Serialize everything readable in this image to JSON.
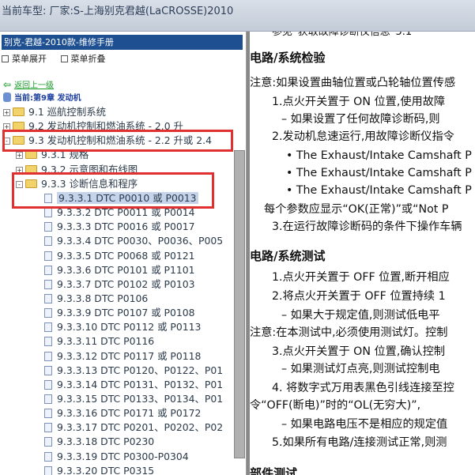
{
  "window": {
    "title": "当前车型:   厂家:S-上海别克君越(LaCROSSE)2010"
  },
  "left_panel": {
    "header": "别克-君越-2010款-维修手册",
    "toolbar": [
      "菜单展开",
      "菜单折叠"
    ],
    "back_link": "返回上一级",
    "chapter": "当前:第9章 发动机",
    "tree": [
      {
        "toggle": "+",
        "icon": "folder",
        "label": "9.1 巡航控制系统"
      },
      {
        "toggle": "+",
        "icon": "folder",
        "label": "9.2 发动机控制和燃油系统 - 2.0 升"
      },
      {
        "toggle": "-",
        "icon": "folder",
        "label": "9.3 发动机控制和燃油系统 - 2.2 升或 2.4"
      },
      {
        "toggle": "+",
        "icon": "folder",
        "label": "9.3.1 规格"
      },
      {
        "toggle": "+",
        "icon": "folder",
        "label": "9.3.2 示意图和布线图"
      },
      {
        "toggle": "-",
        "icon": "folder",
        "label": "9.3.3 诊断信息和程序"
      },
      {
        "toggle": "",
        "icon": "doc",
        "label": "9.3.3.1 DTC P0010 或 P0013",
        "selected": true
      },
      {
        "toggle": "",
        "icon": "doc",
        "label": "9.3.3.2 DTC P0011 或 P0014"
      },
      {
        "toggle": "",
        "icon": "doc",
        "label": "9.3.3.3 DTC P0016 或 P0017"
      },
      {
        "toggle": "",
        "icon": "doc",
        "label": "9.3.3.4 DTC P0030、P0036、P005"
      },
      {
        "toggle": "",
        "icon": "doc",
        "label": "9.3.3.5 DTC P0068 或 P0121"
      },
      {
        "toggle": "",
        "icon": "doc",
        "label": "9.3.3.6 DTC P0101 或 P1101"
      },
      {
        "toggle": "",
        "icon": "doc",
        "label": "9.3.3.7 DTC P0102 或 P0103"
      },
      {
        "toggle": "",
        "icon": "doc",
        "label": "9.3.3.8 DTC P0106"
      },
      {
        "toggle": "",
        "icon": "doc",
        "label": "9.3.3.9 DTC P0107 或 P0108"
      },
      {
        "toggle": "",
        "icon": "doc",
        "label": "9.3.3.10 DTC P0112 或 P0113"
      },
      {
        "toggle": "",
        "icon": "doc",
        "label": "9.3.3.11 DTC P0116"
      },
      {
        "toggle": "",
        "icon": "doc",
        "label": "9.3.3.12 DTC P0117 或 P0118"
      },
      {
        "toggle": "",
        "icon": "doc",
        "label": "9.3.3.13 DTC P0120、P0122、P01"
      },
      {
        "toggle": "",
        "icon": "doc",
        "label": "9.3.3.14 DTC P0131、P0132、P01"
      },
      {
        "toggle": "",
        "icon": "doc",
        "label": "9.3.3.15 DTC P0133、P0134、P01"
      },
      {
        "toggle": "",
        "icon": "doc",
        "label": "9.3.3.16 DTC P0171 或 P0172"
      },
      {
        "toggle": "",
        "icon": "doc",
        "label": "9.3.3.17 DTC P0201、P0202、P02"
      },
      {
        "toggle": "",
        "icon": "doc",
        "label": "9.3.3.18 DTC P0230"
      },
      {
        "toggle": "",
        "icon": "doc",
        "label": "9.3.3.19 DTC P0300-P0304"
      },
      {
        "toggle": "",
        "icon": "doc",
        "label": "9.3.3.20 DTC P0315"
      }
    ]
  },
  "content": {
    "top_line": "参见“获取故障诊断仪信息”5.1",
    "lines": [
      {
        "text": "电路/系统检验",
        "style": "heading"
      },
      {
        "text": "注意:如果设置曲轴位置或凸轮轴位置传感",
        "style": "note"
      },
      {
        "text": "1.点火开关置于 ON 位置,使用故障",
        "style": "step"
      },
      {
        "text": "– 如果设置了任何故障诊断码,则",
        "style": "sub"
      },
      {
        "text": "2.发动机怠速运行,用故障诊断仪指令",
        "style": "step"
      },
      {
        "text": "• The Exhaust/Intake Camshaft P",
        "style": "bullet"
      },
      {
        "text": "• The Exhaust/Intake Camshaft P",
        "style": "bullet"
      },
      {
        "text": "• The Exhaust/Intake Camshaft P",
        "style": "bullet"
      },
      {
        "text": "每个参数应显示“OK(正常)”或“Not P",
        "style": "plain"
      },
      {
        "text": "3.在运行故障诊断码的条件下操作车辆",
        "style": "step"
      },
      {
        "text": "电路/系统测试",
        "style": "heading"
      },
      {
        "text": "1.点火开关置于 OFF 位置,断开相应",
        "style": "step"
      },
      {
        "text": "2.将点火开关置于 OFF 位置持续 1",
        "style": "step"
      },
      {
        "text": "– 如果大于规定值,则测试低电平",
        "style": "sub"
      },
      {
        "text": "注意:在本测试中,必须使用测试灯。控制",
        "style": "note"
      },
      {
        "text": "3.点火开关置于 ON 位置,确认控制",
        "style": "step"
      },
      {
        "text": "– 如果测试灯点亮,则测试控制电",
        "style": "sub"
      },
      {
        "text": "4. 将数字式万用表黑色引线连接至控",
        "style": "step"
      },
      {
        "text": "令“OFF(断电)”时的“OL(无穷大)”,",
        "style": "note"
      },
      {
        "text": "– 如果电路电压不是相应的规定值",
        "style": "sub"
      },
      {
        "text": "5.如果所有电路/连接测试正常,则测",
        "style": "step"
      },
      {
        "text": "部件测试",
        "style": "heading"
      }
    ]
  }
}
